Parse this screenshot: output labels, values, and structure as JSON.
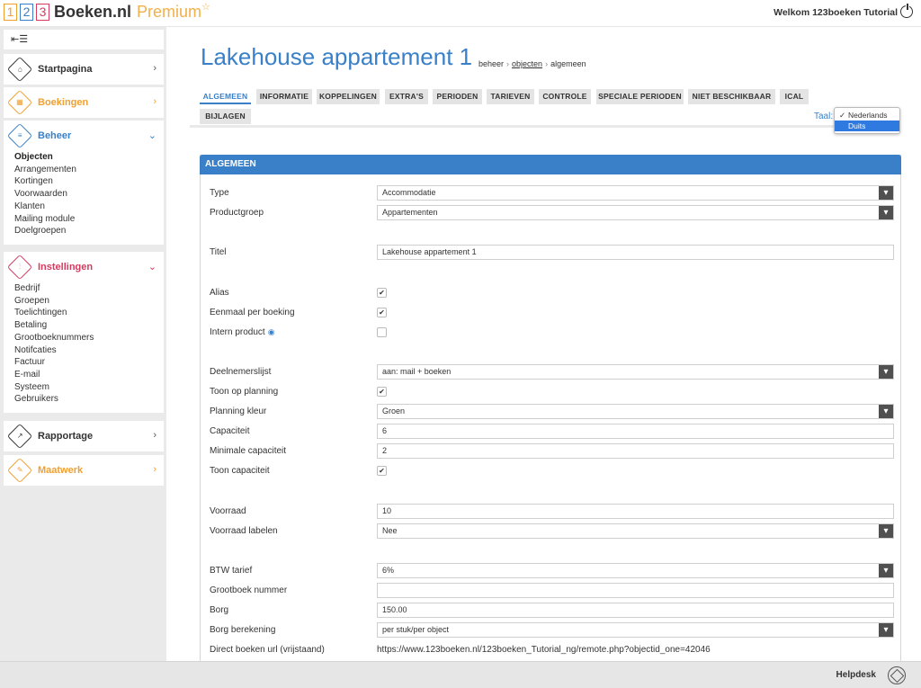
{
  "header": {
    "logo_digits": [
      "1",
      "2",
      "3"
    ],
    "brand": "Boeken.nl",
    "premium": "Premium",
    "welcome": "Welkom 123boeken Tutorial"
  },
  "sidebar": {
    "menu_icon": "menu-collapse-icon",
    "sections": [
      {
        "label": "Startpagina",
        "icon": "home-icon",
        "color": "#333333",
        "expanded": false
      },
      {
        "label": "Boekingen",
        "icon": "calendar-icon",
        "color": "#f0a030",
        "expanded": false
      },
      {
        "label": "Beheer",
        "icon": "list-icon",
        "color": "#3a80c8",
        "expanded": true,
        "items": [
          "Objecten",
          "Arrangementen",
          "Kortingen",
          "Voorwaarden",
          "Klanten",
          "Mailing module",
          "Doelgroepen"
        ]
      },
      {
        "label": "Instellingen",
        "icon": "sliders-icon",
        "color": "#d63a5e",
        "expanded": true,
        "items": [
          "Bedrijf",
          "Groepen",
          "Toelichtingen",
          "Betaling",
          "Grootboeknummers",
          "Notifcaties",
          "Factuur",
          "E-mail",
          "Systeem",
          "Gebruikers"
        ]
      },
      {
        "label": "Rapportage",
        "icon": "trend-icon",
        "color": "#333333",
        "expanded": false
      },
      {
        "label": "Maatwerk",
        "icon": "edit-icon",
        "color": "#f0a030",
        "expanded": false
      }
    ]
  },
  "page": {
    "title": "Lakehouse appartement 1",
    "breadcrumb": [
      "beheer",
      "objecten",
      "algemeen"
    ]
  },
  "tabs": [
    "ALGEMEEN",
    "INFORMATIE",
    "KOPPELINGEN",
    "EXTRA'S",
    "PERIODEN",
    "TARIEVEN",
    "CONTROLE",
    "SPECIALE PERIODEN",
    "NIET BESCHIKBAAR",
    "ICAL",
    "BIJLAGEN"
  ],
  "language": {
    "label": "Taal:",
    "options": [
      "Nederlands",
      "Duits"
    ],
    "selected": "Nederlands",
    "highlighted": "Duits"
  },
  "form": {
    "heading": "ALGEMEEN",
    "type": {
      "label": "Type",
      "value": "Accommodatie"
    },
    "productgroep": {
      "label": "Productgroep",
      "value": "Appartementen"
    },
    "titel": {
      "label": "Titel",
      "value": "Lakehouse appartement 1"
    },
    "alias": {
      "label": "Alias",
      "checked": true
    },
    "eenmaal": {
      "label": "Eenmaal per boeking",
      "checked": true
    },
    "intern": {
      "label": "Intern product",
      "checked": false
    },
    "deelnemerslijst": {
      "label": "Deelnemerslijst",
      "value": "aan: mail + boeken"
    },
    "toon_planning": {
      "label": "Toon op planning",
      "checked": true
    },
    "planning_kleur": {
      "label": "Planning kleur",
      "value": "Groen"
    },
    "capaciteit": {
      "label": "Capaciteit",
      "value": "6"
    },
    "min_capaciteit": {
      "label": "Minimale capaciteit",
      "value": "2"
    },
    "toon_capaciteit": {
      "label": "Toon capaciteit",
      "checked": true
    },
    "voorraad": {
      "label": "Voorraad",
      "value": "10"
    },
    "voorraad_labelen": {
      "label": "Voorraad labelen",
      "value": "Nee"
    },
    "btw": {
      "label": "BTW tarief",
      "value": "6%"
    },
    "grootboek": {
      "label": "Grootboek nummer",
      "value": ""
    },
    "borg": {
      "label": "Borg",
      "value": "150.00"
    },
    "borg_berekening": {
      "label": "Borg berekening",
      "value": "per stuk/per object"
    },
    "direct_url": {
      "label": "Direct boeken url (vrijstaand)",
      "value": "https://www.123boeken.nl/123boeken_Tutorial_ng/remote.php?objectid_one=42046"
    }
  },
  "footer": {
    "helpdesk": "Helpdesk"
  }
}
